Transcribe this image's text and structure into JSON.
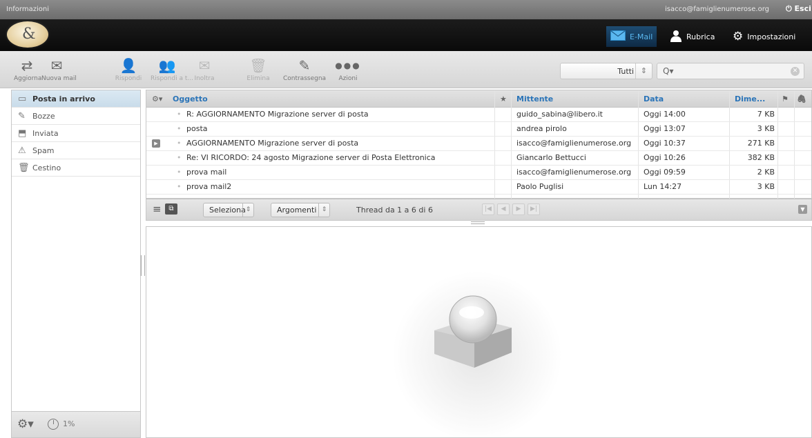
{
  "topbar": {
    "info": "Informazioni",
    "user": "isacco@famiglienumerose.org",
    "logout": "Esci"
  },
  "nav": {
    "email": "E-Mail",
    "contacts": "Rubrica",
    "settings": "Impostazioni"
  },
  "toolbar": {
    "refresh": "Aggiorna",
    "compose": "Nuova mail",
    "reply": "Rispondi",
    "reply_all": "Rispondi a t...",
    "forward": "Inoltra",
    "delete": "Elimina",
    "mark": "Contrassegna",
    "more": "Azioni",
    "filter_value": "Tutti",
    "search_placeholder": ""
  },
  "folders": [
    {
      "label": "Posta in arrivo",
      "icon": "inbox-icon"
    },
    {
      "label": "Bozze",
      "icon": "pencil-icon"
    },
    {
      "label": "Inviata",
      "icon": "sent-icon"
    },
    {
      "label": "Spam",
      "icon": "spam-icon"
    },
    {
      "label": "Cestino",
      "icon": "trash-icon"
    }
  ],
  "quota": "1%",
  "list": {
    "columns": {
      "subject": "Oggetto",
      "from": "Mittente",
      "date": "Data",
      "size": "Dime..."
    },
    "messages": [
      {
        "subject": "R: AGGIORNAMENTO Migrazione server di posta",
        "from": "guido_sabina@libero.it",
        "date": "Oggi 14:00",
        "size": "7 KB",
        "thread": false
      },
      {
        "subject": "posta",
        "from": "andrea pirolo",
        "date": "Oggi 13:07",
        "size": "3 KB",
        "thread": false
      },
      {
        "subject": "AGGIORNAMENTO Migrazione server di posta",
        "from": "isacco@famiglienumerose.org",
        "date": "Oggi 10:37",
        "size": "271 KB",
        "thread": true
      },
      {
        "subject": "Re: VI RICORDO: 24 agosto Migrazione server di Posta Elettronica",
        "from": "Giancarlo Bettucci",
        "date": "Oggi 10:26",
        "size": "382 KB",
        "thread": false
      },
      {
        "subject": "prova mail",
        "from": "isacco@famiglienumerose.org",
        "date": "Oggi 09:59",
        "size": "2 KB",
        "thread": false
      },
      {
        "subject": "prova mail2",
        "from": "Paolo Puglisi",
        "date": "Lun 14:27",
        "size": "3 KB",
        "thread": false
      }
    ]
  },
  "listfooter": {
    "select": "Seleziona",
    "threads": "Argomenti",
    "count": "Thread da 1 a 6 di 6"
  },
  "colors": {
    "accent": "#2a74b8",
    "header": "#111111",
    "selected": "#c9dcea"
  }
}
